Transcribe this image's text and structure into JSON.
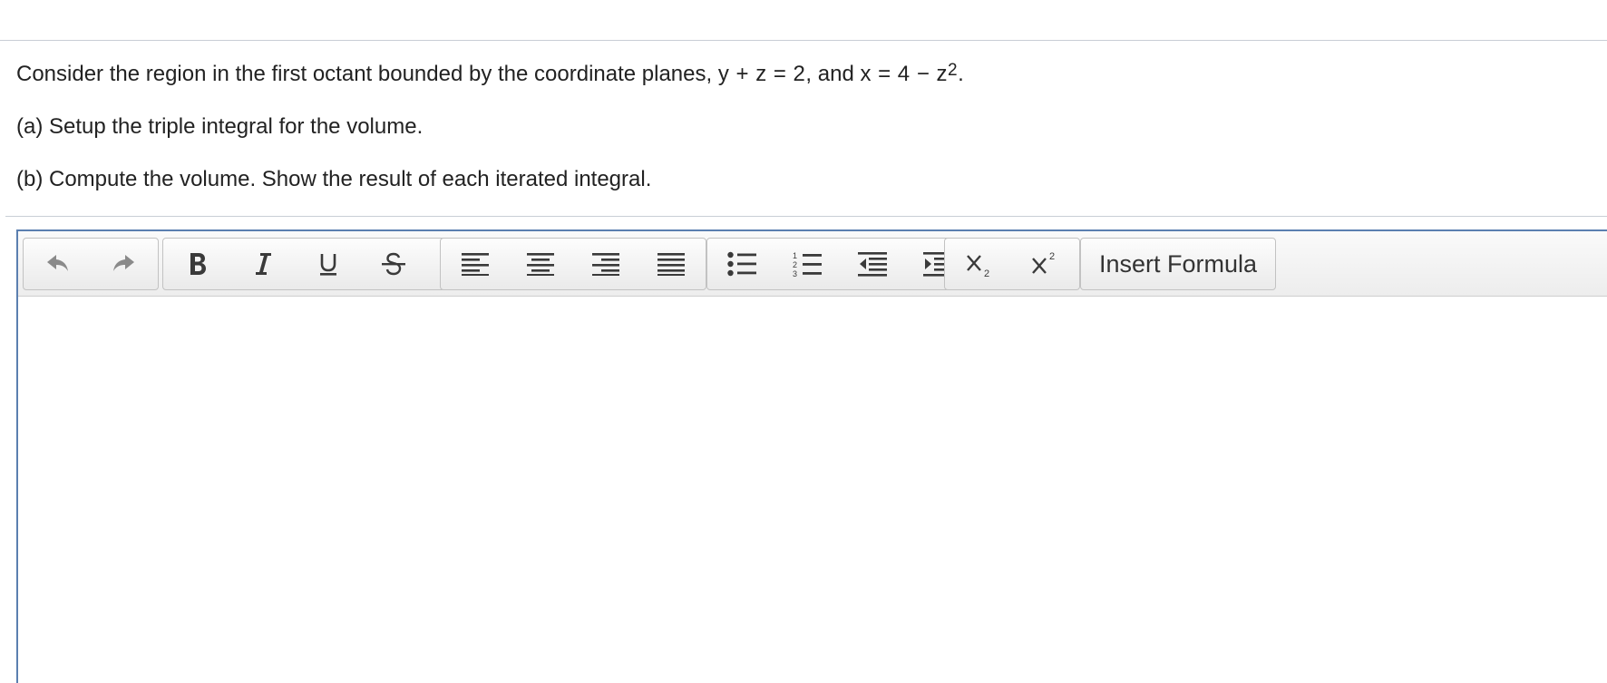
{
  "question": {
    "intro_text": "Consider the region in the first octant bounded by the coordinate planes, ",
    "plane_eq": "y + z = 2",
    "mid_text": ", and ",
    "surface_eq_base": "x = 4 − z",
    "surface_exponent": "2",
    "end_text": ".",
    "part_a": "(a) Setup the triple integral for the volume.",
    "part_b": "(b) Compute the volume.  Show the result of each iterated integral."
  },
  "toolbar": {
    "insert_formula_label": "Insert Formula",
    "icons": {
      "undo": "undo-icon",
      "redo": "redo-icon",
      "bold": "bold-icon",
      "italic": "italic-icon",
      "underline": "underline-icon",
      "strikethrough": "strikethrough-icon",
      "clear_format": "clear-format-icon",
      "align_left": "align-left-icon",
      "align_center": "align-center-icon",
      "align_right": "align-right-icon",
      "align_justify": "align-justify-icon",
      "bullet_list": "bullet-list-icon",
      "numbered_list": "numbered-list-icon",
      "outdent": "outdent-icon",
      "indent": "indent-icon",
      "subscript": "subscript-icon",
      "superscript": "superscript-icon"
    }
  },
  "colors": {
    "editor_border": "#5b7fb0",
    "rule": "#c9ced6",
    "icon": "#3a3a3a",
    "icon_disabled": "#8a8a8a"
  }
}
